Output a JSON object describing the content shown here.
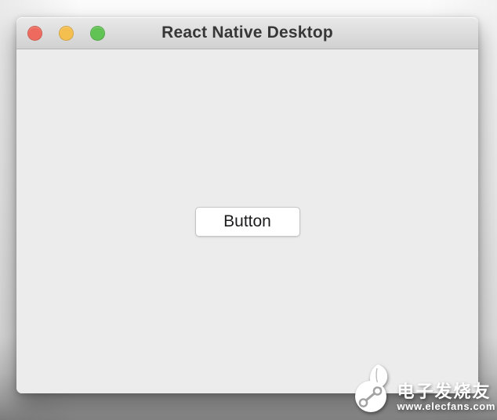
{
  "window": {
    "title": "React Native Desktop",
    "traffic_lights": [
      {
        "name": "close",
        "color": "#ee6a5e"
      },
      {
        "name": "minimize",
        "color": "#f5bf4f"
      },
      {
        "name": "zoom",
        "color": "#61c354"
      }
    ]
  },
  "content": {
    "button_label": "Button"
  },
  "watermark": {
    "brand": "电子发烧友",
    "url": "www.elecfans.com",
    "logo": "elecfans-leaf-circuit-icon"
  },
  "colors": {
    "close_red": "#ee6a5e",
    "minimize_yellow": "#f5bf4f",
    "zoom_green": "#61c354",
    "titlebar_top": "#e9e9e9",
    "titlebar_bottom": "#d1d1d1",
    "titlebar_border": "#b5b5b5",
    "window_bg": "#ececec",
    "button_bg": "#ffffff",
    "button_border": "#c6c6c6",
    "button_text": "#1c1c1e",
    "title_text": "#373737",
    "desktop_dark": "#868686",
    "watermark_white": "#ffffff"
  }
}
